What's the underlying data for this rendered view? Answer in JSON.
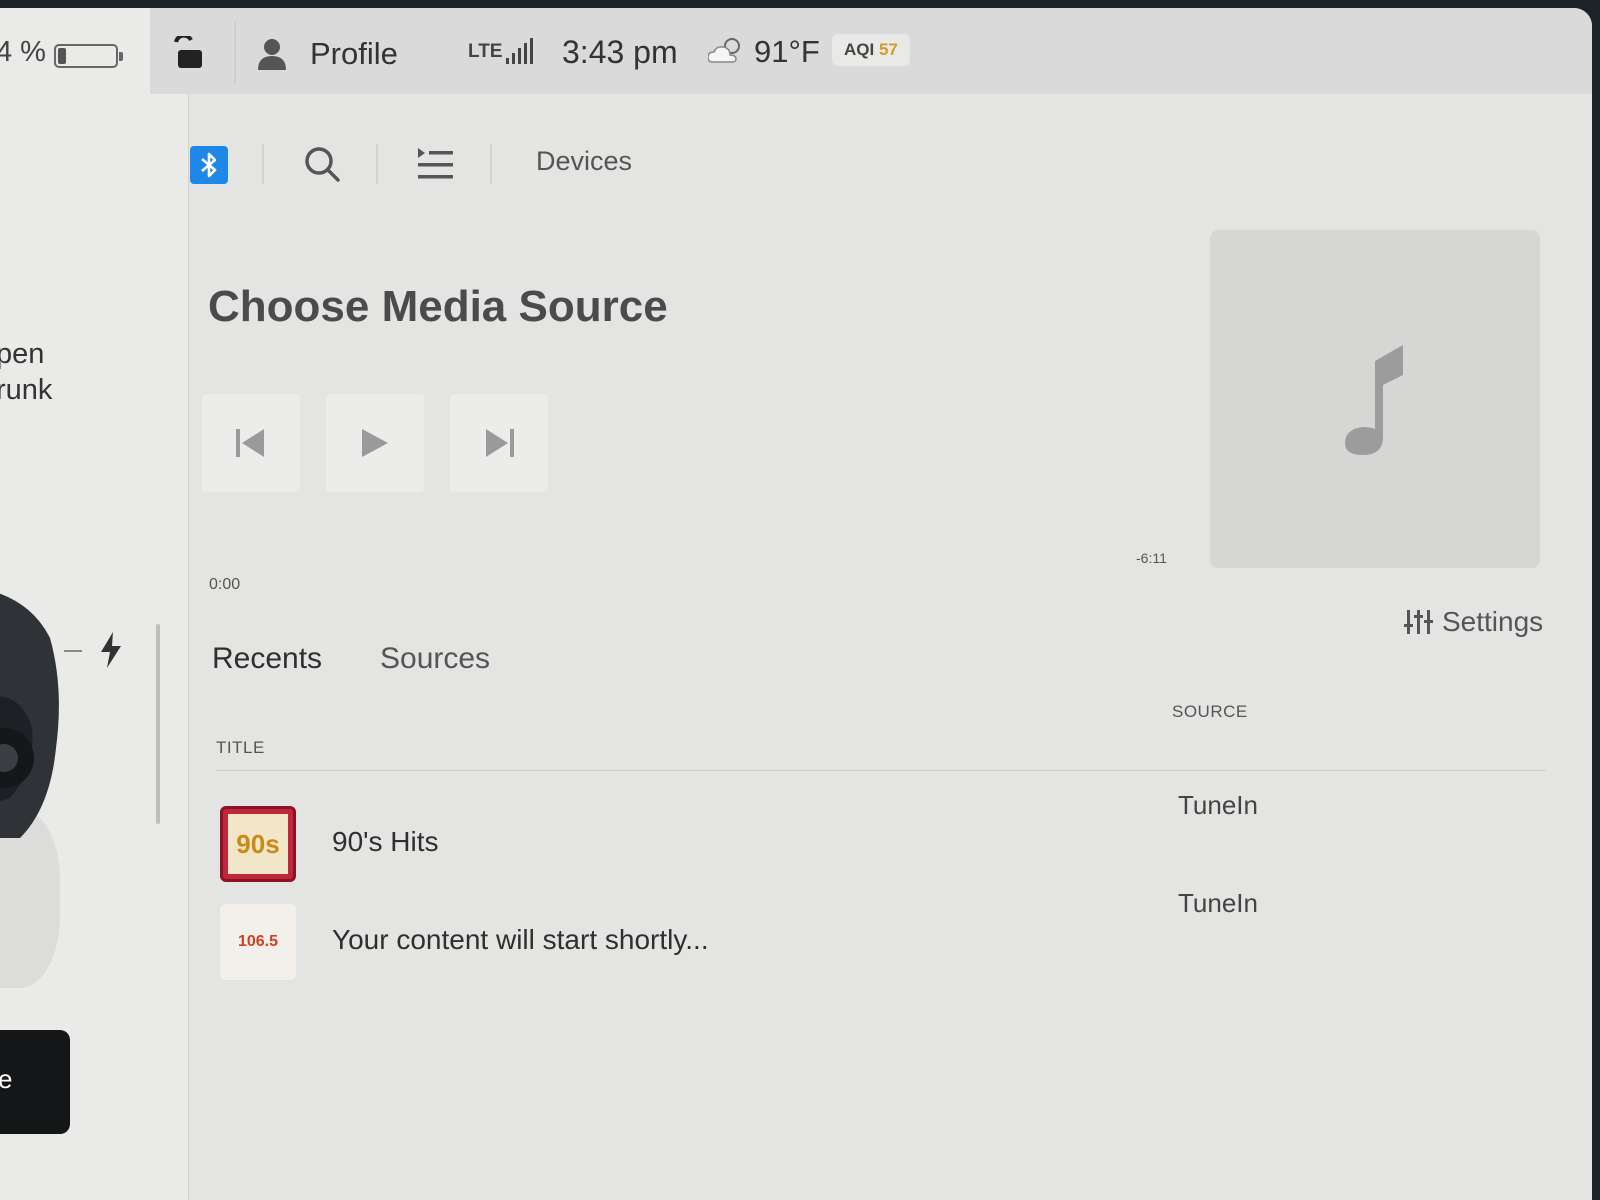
{
  "status": {
    "battery_percent": "4 %",
    "battery_level": 0.15,
    "profile_label": "Profile",
    "network": "LTE",
    "time": "3:43 pm",
    "temperature": "91°F",
    "aqi_label": "AQI",
    "aqi_value": "57"
  },
  "car_panel": {
    "trunk_label": "pen\nrunk",
    "dark_button_label": "e"
  },
  "toolbar": {
    "devices_label": "Devices",
    "bluetooth_color": "#1f87e8"
  },
  "player": {
    "title": "Choose Media Source",
    "elapsed": "0:00",
    "remaining": "-6:11",
    "settings_label": "Settings"
  },
  "tabs": [
    {
      "label": "Recents",
      "active": true
    },
    {
      "label": "Sources",
      "active": false
    }
  ],
  "table": {
    "col_title": "TITLE",
    "col_source": "SOURCE",
    "rows": [
      {
        "title": "90's Hits",
        "source": "TuneIn",
        "thumb_text": "90s"
      },
      {
        "title": "Your content will start shortly...",
        "source": "TuneIn",
        "thumb_text": "106.5"
      }
    ]
  }
}
